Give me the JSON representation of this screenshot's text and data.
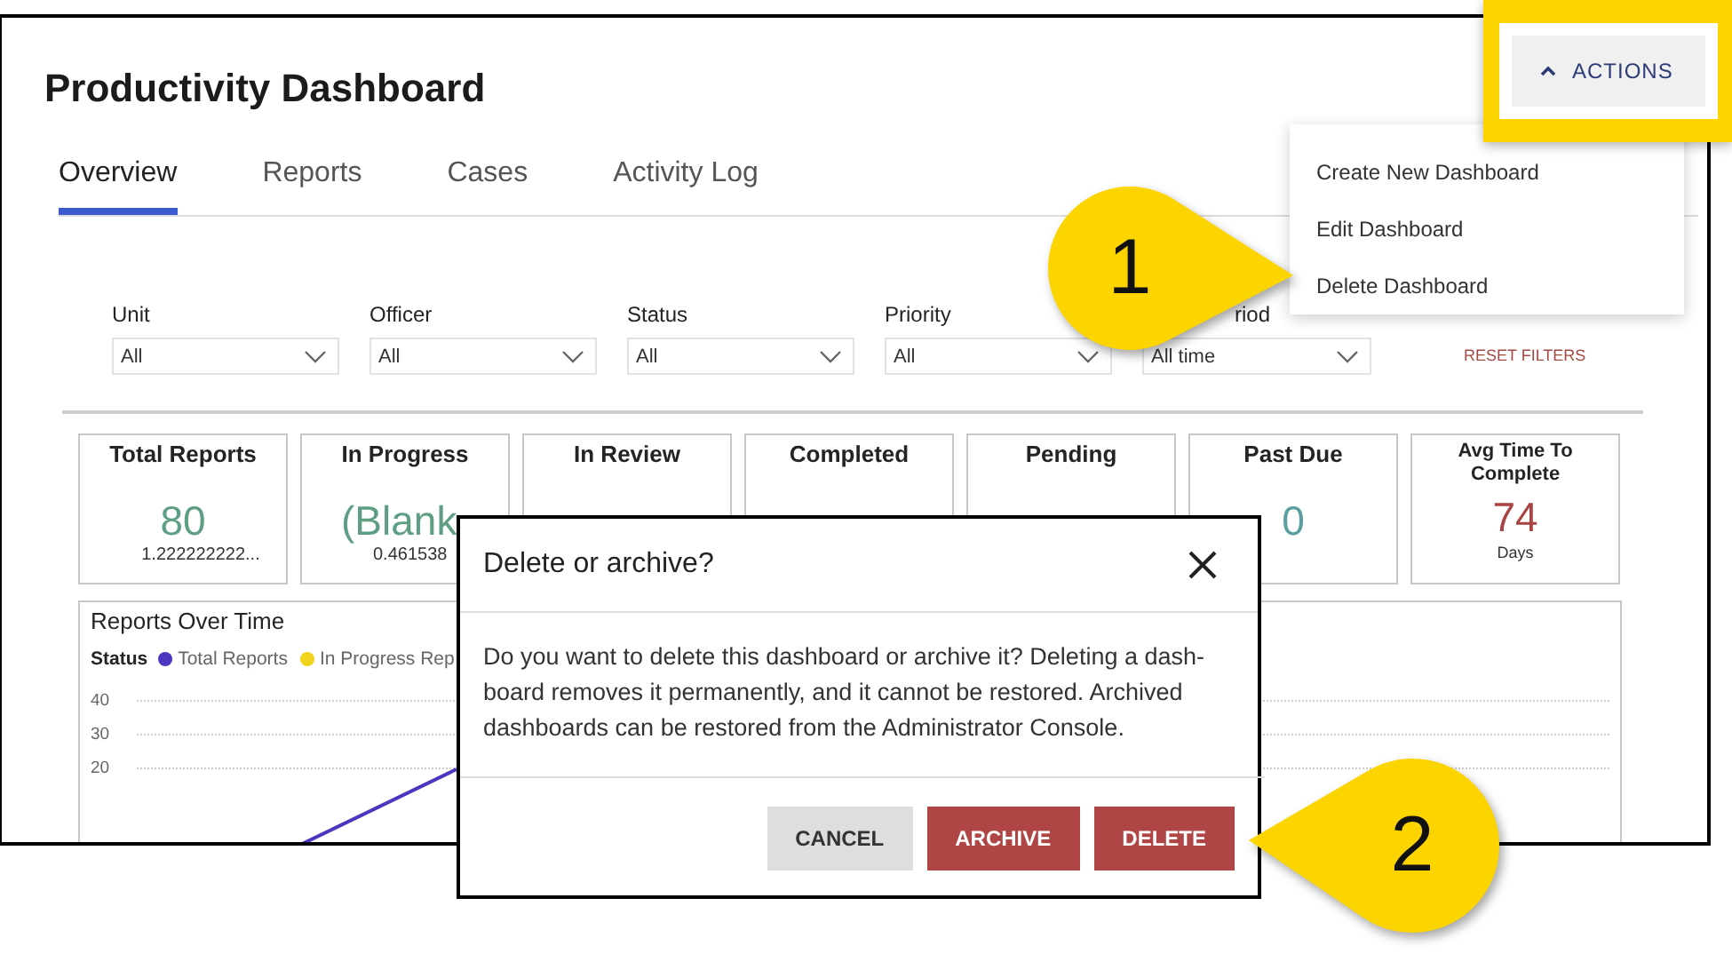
{
  "page_title": "Productivity Dashboard",
  "tabs": [
    {
      "label": "Overview",
      "selected": true
    },
    {
      "label": "Reports",
      "selected": false
    },
    {
      "label": "Cases",
      "selected": false
    },
    {
      "label": "Activity Log",
      "selected": false
    }
  ],
  "actions_button": {
    "label": "ACTIONS",
    "expanded": true
  },
  "actions_menu": [
    "Create New Dashboard",
    "Edit Dashboard",
    "Delete Dashboard"
  ],
  "filters": [
    {
      "label": "Unit",
      "value": "All"
    },
    {
      "label": "Officer",
      "value": "All"
    },
    {
      "label": "Status",
      "value": "All"
    },
    {
      "label": "Priority",
      "value": "All"
    },
    {
      "label": "riod",
      "value": "All time"
    }
  ],
  "reset_filters": "RESET FILTERS",
  "cards": [
    {
      "title": "Total Reports",
      "value": "80",
      "subtext": "1.222222222...",
      "color": "#5e9e82"
    },
    {
      "title": "In Progress",
      "value": "(Blank",
      "subtext": "0.461538",
      "color": "#5e9e82"
    },
    {
      "title": "In Review"
    },
    {
      "title": "Completed"
    },
    {
      "title": "Pending"
    },
    {
      "title": "Past Due",
      "value": "0",
      "color": "#5a9ea0"
    },
    {
      "title": "Avg Time To Complete",
      "value": "74",
      "subtext": "Days",
      "color": "#a94444"
    }
  ],
  "chart": {
    "title": "Reports Over Time",
    "legend_title": "Status",
    "legend": [
      {
        "label": "Total Reports",
        "color": "#4b36c0"
      },
      {
        "label": "In Progress Rep",
        "color": "#f2d31b"
      }
    ],
    "y_tick_labels": [
      "40",
      "30",
      "20"
    ]
  },
  "dialog": {
    "title": "Delete or archive?",
    "message": "Do you want to delete this dashboard or archive it? Deleting a dash-board removes it permanently, and it cannot be restored. Archived dashboards can be restored from the Administrator Console.",
    "buttons": [
      {
        "label": "CANCEL",
        "kind": "secondary"
      },
      {
        "label": "ARCHIVE",
        "kind": "danger"
      },
      {
        "label": "DELETE",
        "kind": "danger"
      }
    ]
  },
  "callouts": [
    {
      "number": "1"
    },
    {
      "number": "2"
    }
  ]
}
